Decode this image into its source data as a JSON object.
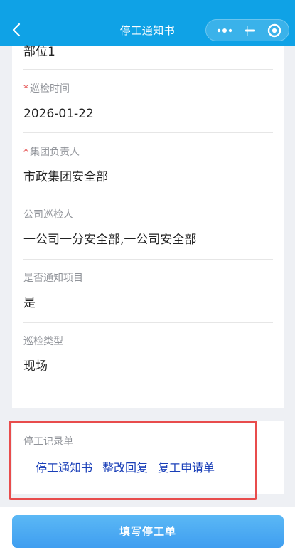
{
  "nav": {
    "title": "停工通知书"
  },
  "form": {
    "fields": [
      {
        "label": "",
        "value": "部位1",
        "required": false
      },
      {
        "label": "巡检时间",
        "value": "2026-01-22",
        "required": true
      },
      {
        "label": "集团负责人",
        "value": "市政集团安全部",
        "required": true
      },
      {
        "label": "公司巡检人",
        "value": "一公司一分安全部,一公司安全部",
        "required": false
      },
      {
        "label": "是否通知项目",
        "value": "是",
        "required": false
      },
      {
        "label": "巡检类型",
        "value": "现场",
        "required": false
      }
    ],
    "required_mark": "*"
  },
  "records": {
    "label": "停工记录单",
    "links": [
      "停工通知书",
      "整改回复",
      "复工申请单"
    ]
  },
  "footer": {
    "submit_label": "填写停工单"
  },
  "colors": {
    "nav_bg": "#0fa2e6",
    "link": "#1a3fb8",
    "required": "#e23a3a",
    "highlight": "#e84c4c",
    "button": "#4aa8f2"
  }
}
